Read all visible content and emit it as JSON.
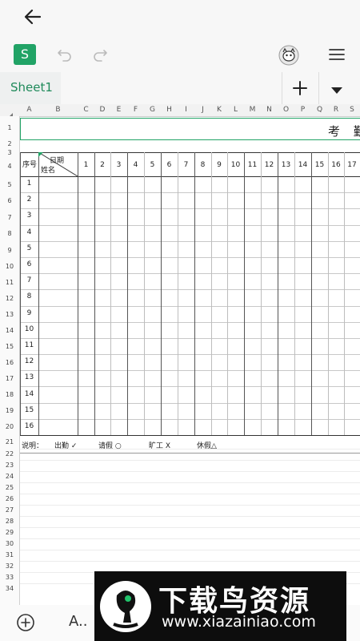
{
  "app": {
    "logo_letter": "S",
    "sheet_tab": "Sheet1"
  },
  "columns": [
    "A",
    "B",
    "C",
    "D",
    "E",
    "F",
    "G",
    "H",
    "I",
    "J",
    "K",
    "L",
    "M",
    "N",
    "O",
    "P",
    "Q",
    "R",
    "S"
  ],
  "title_row": {
    "text": "考 勤"
  },
  "header": {
    "seq": "序号",
    "date_label": "日期",
    "name_label": "姓名",
    "days": [
      "1",
      "2",
      "3",
      "4",
      "5",
      "6",
      "7",
      "8",
      "9",
      "10",
      "11",
      "12",
      "13",
      "14",
      "15",
      "16",
      "17"
    ]
  },
  "entries": [
    "1",
    "2",
    "3",
    "4",
    "5",
    "6",
    "7",
    "8",
    "9",
    "10",
    "11",
    "12",
    "13",
    "14",
    "15",
    "16"
  ],
  "legend": {
    "label": "说明：",
    "items": [
      "出勤 ✓",
      "请假 ○",
      "旷工 X",
      "休假△"
    ]
  },
  "row_numbers": [
    "1",
    "2",
    "3",
    "4",
    "5",
    "6",
    "7",
    "8",
    "9",
    "10",
    "11",
    "12",
    "13",
    "14",
    "15",
    "16",
    "17",
    "18",
    "19",
    "20",
    "21",
    "22",
    "23",
    "24",
    "25",
    "26",
    "27",
    "28",
    "29",
    "30",
    "31",
    "32",
    "33",
    "34"
  ],
  "watermark": {
    "title": "下载鸟资源",
    "url": "www.xiazainiao.com"
  },
  "bottom": {
    "font_label": "A.."
  },
  "colors": {
    "accent": "#21a366",
    "grid": "#d0d0d0",
    "thick": "#555555"
  }
}
